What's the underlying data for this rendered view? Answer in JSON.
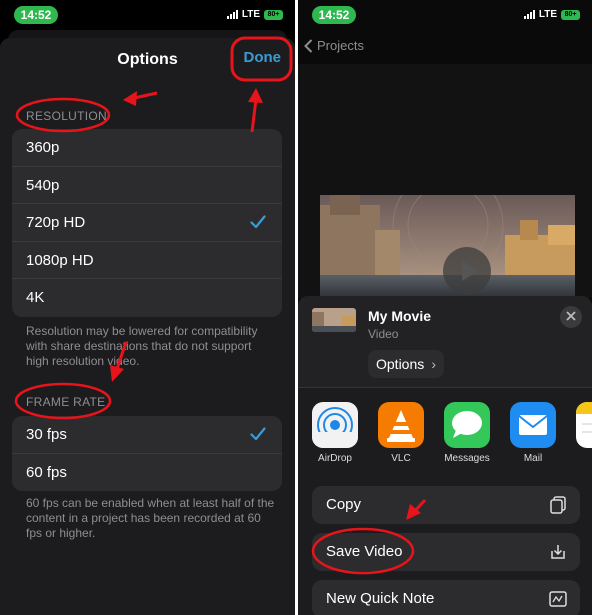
{
  "left": {
    "status": {
      "time": "14:52",
      "network": "LTE",
      "battery": "80+"
    },
    "title": "Options",
    "done_label": "Done",
    "resolution": {
      "header": "RESOLUTION",
      "options": [
        "360p",
        "540p",
        "720p HD",
        "1080p HD",
        "4K"
      ],
      "selected": "720p HD",
      "footnote": "Resolution may be lowered for compatibility with share destinations that do not support high resolution video."
    },
    "frame_rate": {
      "header": "FRAME RATE",
      "options": [
        "30 fps",
        "60 fps"
      ],
      "selected": "30 fps",
      "footnote": "60 fps can be enabled when at least half of the content in a project has been recorded at 60 fps or higher."
    }
  },
  "right": {
    "status": {
      "time": "14:52",
      "network": "LTE",
      "battery": "80+"
    },
    "back_label": "Projects",
    "share": {
      "title": "My Movie",
      "subtitle": "Video",
      "options_label": "Options",
      "apps": [
        {
          "label": "AirDrop",
          "icon": "airdrop-icon"
        },
        {
          "label": "VLC",
          "icon": "vlc-icon"
        },
        {
          "label": "Messages",
          "icon": "messages-icon"
        },
        {
          "label": "Mail",
          "icon": "mail-icon"
        },
        {
          "label": "N",
          "icon": "notes-icon"
        }
      ],
      "actions": [
        {
          "label": "Copy",
          "icon": "copy-icon"
        },
        {
          "label": "Save Video",
          "icon": "save-icon"
        },
        {
          "label": "New Quick Note",
          "icon": "quick-note-icon"
        }
      ]
    }
  },
  "colors": {
    "accent": "#3c9bd6",
    "status_green": "#2fb84f",
    "annotation_red": "#e8141b"
  }
}
